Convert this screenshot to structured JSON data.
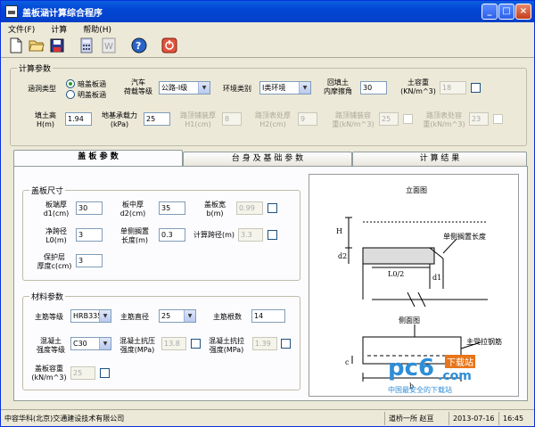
{
  "window": {
    "title": "盖板涵计算综合程序"
  },
  "menu": [
    "文件(F)",
    "计算",
    "帮助(H)"
  ],
  "toolbar": {
    "icons": [
      "new-file-icon",
      "open-folder-icon",
      "save-icon",
      "calculator-icon",
      "word-icon",
      "help-icon",
      "exit-icon"
    ]
  },
  "params": {
    "legend": "计算参数",
    "culvert_type_label": "涵洞类型",
    "culvert_opt1": "暗盖板涵",
    "culvert_opt2": "明盖板涵",
    "load_label1": "汽车",
    "load_label2": "荷载等级",
    "load_value": "公路-I级",
    "env_label": "环境类别",
    "env_value": "I类环境",
    "backfill_label1": "回填土",
    "backfill_label2": "内摩擦角",
    "backfill_value": "30",
    "soil_weight_label1": "土容重",
    "soil_weight_label2": "(KN/m^3)",
    "soil_weight_value": "18",
    "fill_height_label1": "填土高",
    "fill_height_label2": "H(m)",
    "fill_height_value": "1.94",
    "bearing_label1": "地基承载力",
    "bearing_label2": "(kPa)",
    "bearing_value": "25",
    "pave_thick_label1": "路顶铺装厚",
    "pave_thick_label2": "H1(cm)",
    "pave_thick_value": "8",
    "surf_thick_label1": "路顶表处厚",
    "surf_thick_label2": "H2(cm)",
    "surf_thick_value": "9",
    "pave_weight_label1": "路顶铺装容",
    "pave_weight_label2": "重(kN/m^3)",
    "pave_weight_value": "25",
    "surf_weight_label1": "路顶表处容",
    "surf_weight_label2": "重(kN/m^3)",
    "surf_weight_value": "23"
  },
  "tabs": [
    "盖 板 参 数",
    "台 身 及 基 础 参 数",
    "计 算 结 果"
  ],
  "slab": {
    "legend": "盖板尺寸",
    "d1_label1": "板端厚",
    "d1_label2": "d1(cm)",
    "d1_value": "30",
    "d2_label1": "板中厚",
    "d2_label2": "d2(cm)",
    "d2_value": "35",
    "b_label1": "盖板宽",
    "b_label2": "b(m)",
    "b_value": "0.99",
    "l0_label1": "净跨径",
    "l0_label2": "L0(m)",
    "l0_value": "3",
    "bearing_len_label1": "单侧搁置",
    "bearing_len_label2": "长度(m)",
    "bearing_len_value": "0.3",
    "calc_span_label": "计算跨径(m)",
    "calc_span_value": "3.3",
    "cover_label1": "保护层",
    "cover_label2": "厚度c(cm)",
    "cover_value": "3"
  },
  "material": {
    "legend": "材料参数",
    "rebar_grade_label": "主筋等级",
    "rebar_grade_value": "HRB335",
    "rebar_dia_label": "主筋直径",
    "rebar_dia_value": "25",
    "rebar_count_label": "主筋根数",
    "rebar_count_value": "14",
    "concrete_label1": "混凝土",
    "concrete_label2": "强度等级",
    "concrete_value": "C30",
    "comp_label1": "混凝土抗压",
    "comp_label2": "强度(MPa)",
    "comp_value": "13.8",
    "tens_label1": "混凝土抗拉",
    "tens_label2": "强度(MPa)",
    "tens_value": "1.39",
    "slab_weight_label1": "盖板容重",
    "slab_weight_label2": "(kN/m^3)",
    "slab_weight_value": "25"
  },
  "diagram": {
    "elev_title": "立面图",
    "side_title": "侧面图",
    "H": "H",
    "d2": "d2",
    "d1": "d1",
    "L0half": "L0/2",
    "bearing": "单侧搁置长度",
    "c": "c",
    "b": "b",
    "rebar": "主受拉钢筋"
  },
  "watermark": {
    "brand": "pc6",
    "dotcom": ".com",
    "download": "下载站",
    "slogan": "中国最安全的下载站"
  },
  "status": {
    "company": "中容华科(北京)交通建设技术有限公司",
    "author": "道桥一所 赵亘",
    "date": "2013-07-16",
    "time": "16:45"
  }
}
